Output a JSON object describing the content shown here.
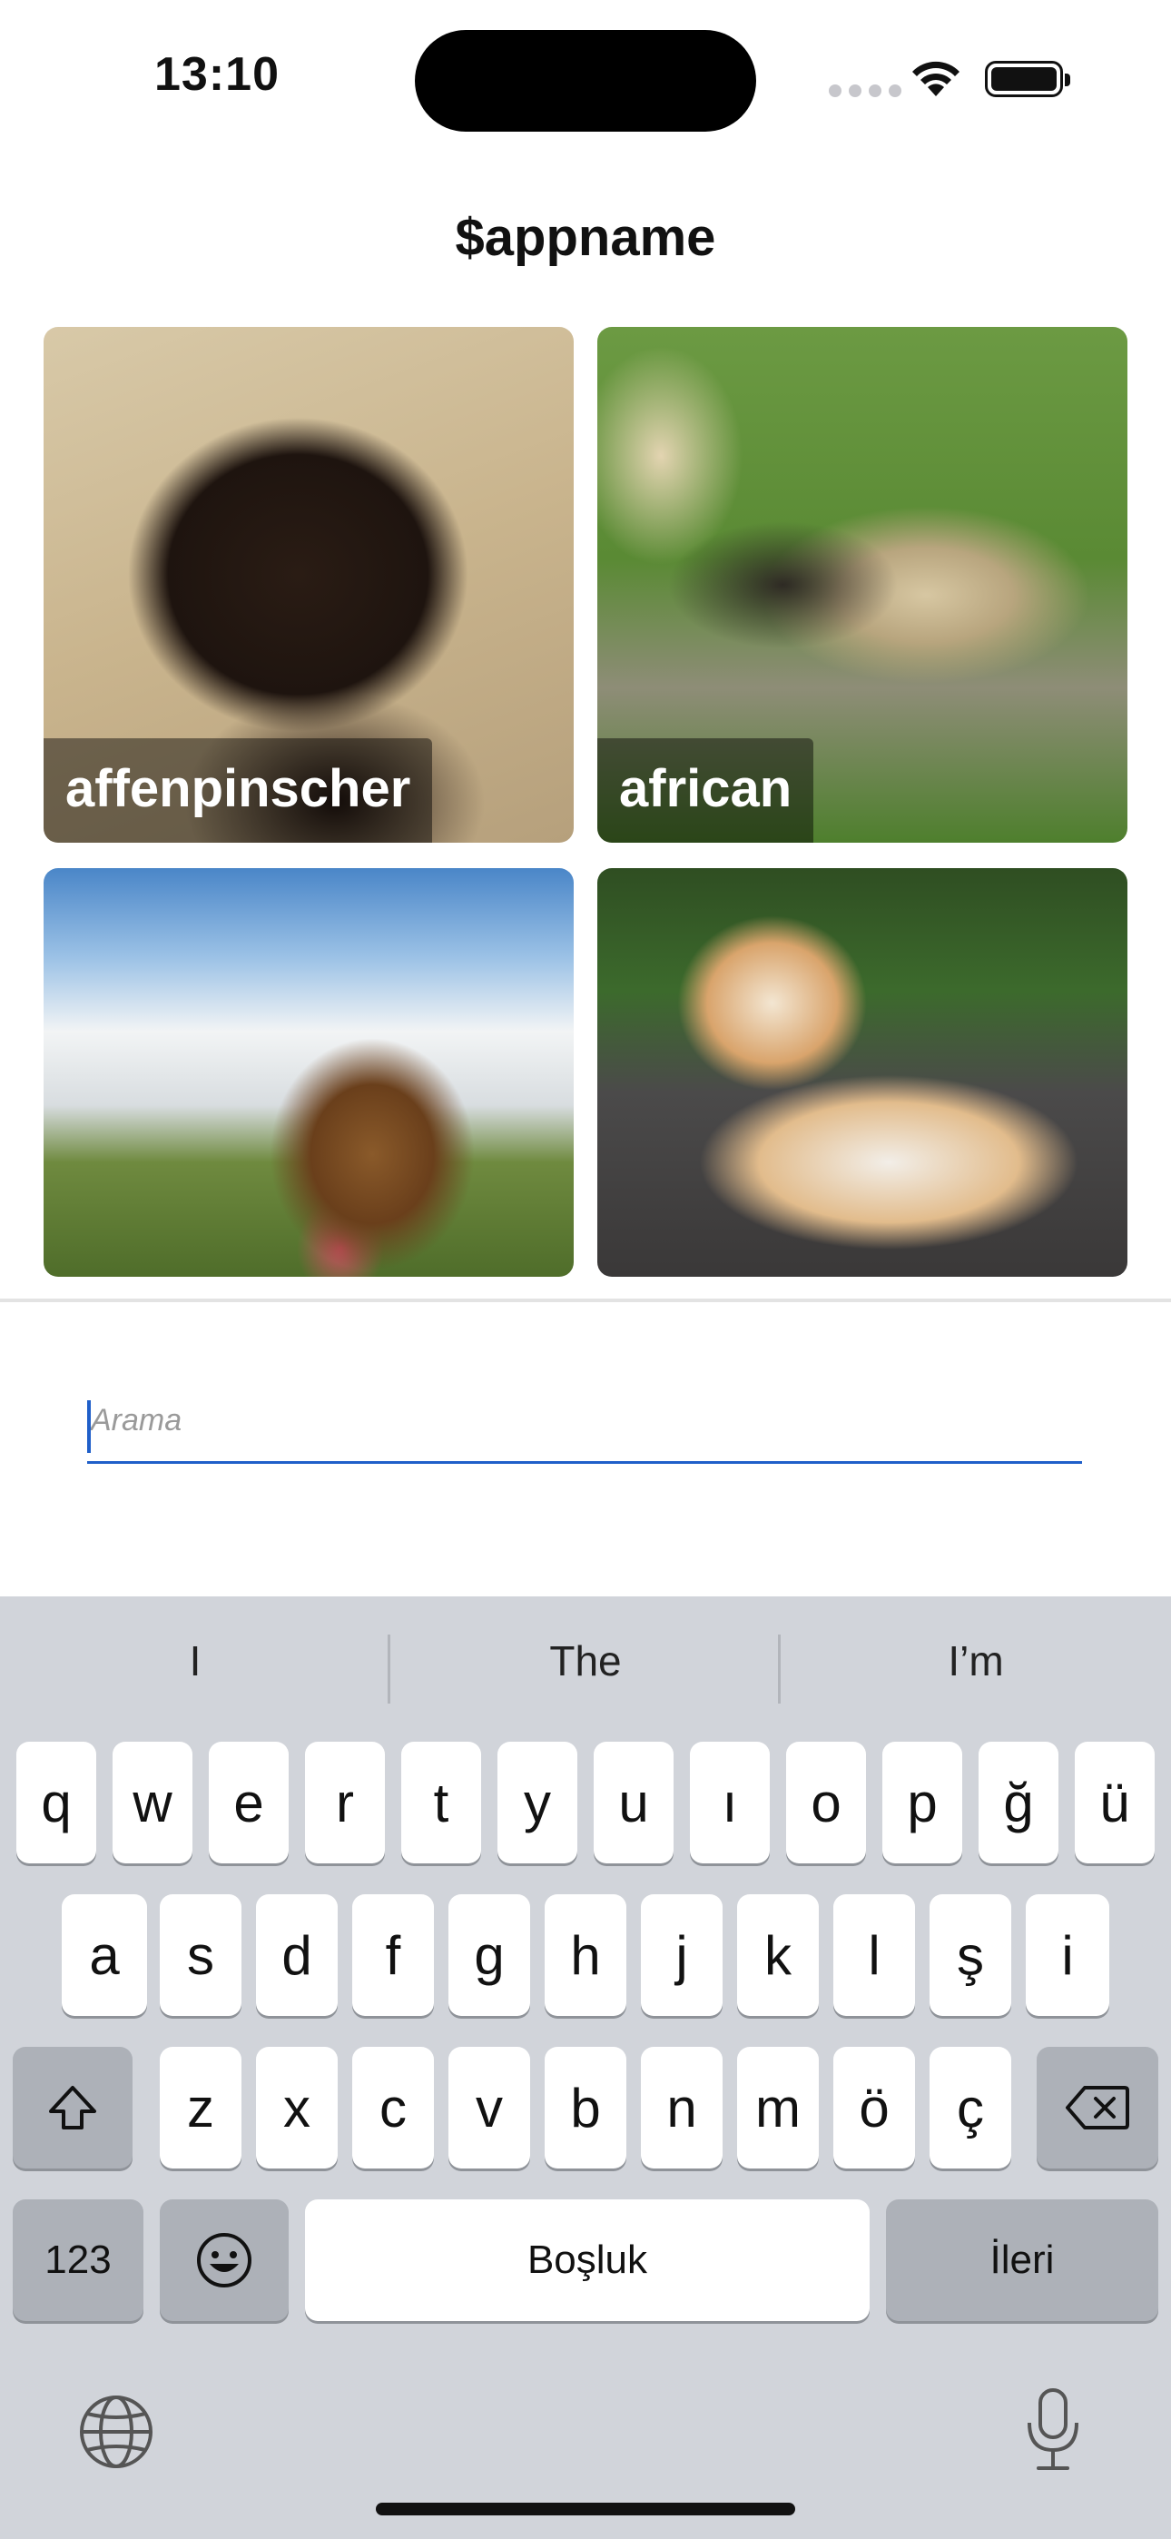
{
  "status_bar": {
    "time": "13:10"
  },
  "header": {
    "title": "$appname"
  },
  "breeds": [
    {
      "label": "affenpinscher"
    },
    {
      "label": "african"
    },
    {
      "label": ""
    },
    {
      "label": ""
    }
  ],
  "search": {
    "placeholder": "Arama",
    "value": ""
  },
  "keyboard": {
    "suggestions": [
      "I",
      "The",
      "I’m"
    ],
    "row1": [
      "q",
      "w",
      "e",
      "r",
      "t",
      "y",
      "u",
      "ı",
      "o",
      "p",
      "ğ",
      "ü"
    ],
    "row2": [
      "a",
      "s",
      "d",
      "f",
      "g",
      "h",
      "j",
      "k",
      "l",
      "ş",
      "i"
    ],
    "row3": [
      "z",
      "x",
      "c",
      "v",
      "b",
      "n",
      "m",
      "ö",
      "ç"
    ],
    "numbers_label": "123",
    "space_label": "Boşluk",
    "return_label": "İleri"
  }
}
